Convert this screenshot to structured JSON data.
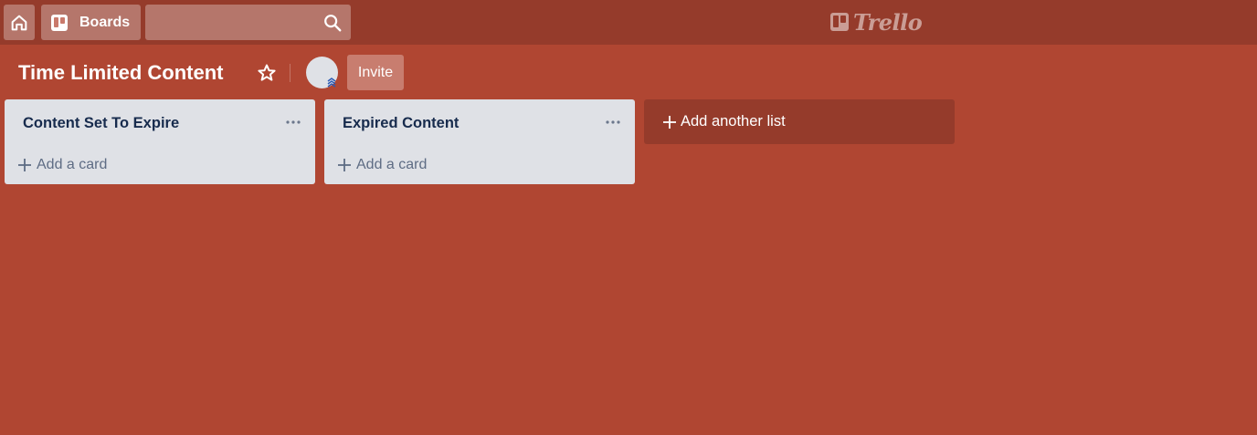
{
  "header": {
    "home_icon": "home-icon",
    "boards_label": "Boards",
    "boards_icon": "boards-icon",
    "search": {
      "value": "",
      "placeholder": "",
      "icon": "search-icon"
    },
    "logo_text": "Trello"
  },
  "board": {
    "title": "Time Limited Content",
    "star_icon": "star-icon",
    "invite_label": "Invite"
  },
  "lists": [
    {
      "title": "Content Set To Expire",
      "add_card_label": "Add a card"
    },
    {
      "title": "Expired Content",
      "add_card_label": "Add a card"
    }
  ],
  "add_list_label": "Add another list",
  "colors": {
    "board_background": "#b04632",
    "header_background": "#953b2b",
    "list_background": "#dfe1e6",
    "list_title": "#172b4d",
    "add_card_text": "#5e6c84"
  }
}
